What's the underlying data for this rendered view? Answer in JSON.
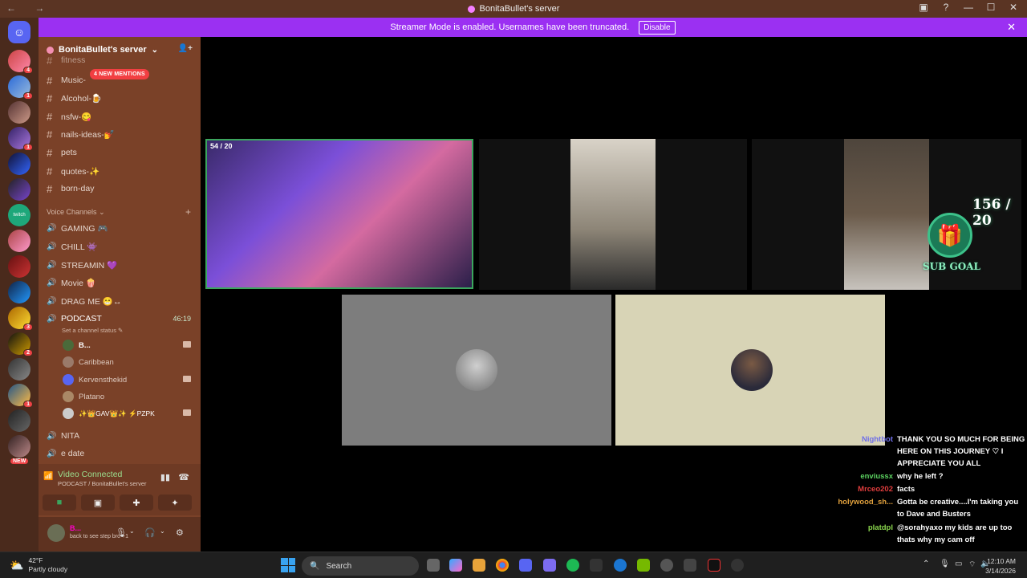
{
  "window": {
    "title": "BonitaBullet's server",
    "nav": "← →"
  },
  "window_controls": [
    "▣",
    "?",
    "—",
    "☐",
    "✕"
  ],
  "streamer_bar": {
    "message": "Streamer Mode is enabled. Usernames have been truncated.",
    "button": "Disable",
    "close": "✕"
  },
  "guilds": [
    {
      "badge": ""
    },
    {
      "badge": "4"
    },
    {
      "badge": "1"
    },
    {
      "badge": ""
    },
    {
      "badge": "1"
    },
    {
      "badge": ""
    },
    {
      "badge": ""
    },
    {
      "badge": ""
    },
    {
      "badge": ""
    },
    {
      "badge": ""
    },
    {
      "badge": ""
    },
    {
      "badge": "3"
    },
    {
      "badge": "2"
    },
    {
      "badge": ""
    },
    {
      "badge": "1"
    },
    {
      "badge": ""
    },
    {
      "badge": "NEW"
    }
  ],
  "server": {
    "name": "BonitaBullet's server",
    "chevron": "⌄",
    "invite_icon": "👤+"
  },
  "mentions_pill": "4 NEW MENTIONS",
  "text_channels": [
    {
      "name": "fitness"
    },
    {
      "name": "Music-"
    },
    {
      "name": "Alcohol-🍺"
    },
    {
      "name": "nsfw-😋"
    },
    {
      "name": "nails-ideas-💅"
    },
    {
      "name": "pets"
    },
    {
      "name": "quotes-✨"
    },
    {
      "name": "born-day"
    }
  ],
  "voice_header": "Voice Channels",
  "voice_channels": [
    {
      "name": "GAMING 🎮"
    },
    {
      "name": "CHILL 👾"
    },
    {
      "name": "STREAMIN 💜"
    },
    {
      "name": "Movie 🍿"
    },
    {
      "name": "DRAG ME 😁↔"
    },
    {
      "name": "PODCAST",
      "time": "46:19"
    }
  ],
  "podcast_status": "Set a channel status ✎",
  "members": [
    {
      "name": "B...",
      "cam": true
    },
    {
      "name": "Caribbean",
      "cam": false
    },
    {
      "name": "Kervensthekid",
      "cam": true
    },
    {
      "name": "Platano",
      "cam": false
    },
    {
      "name": "✨👑GAV👑✨ ⚡PZPK",
      "cam": true
    }
  ],
  "more_channels": [
    {
      "name": "NITA"
    },
    {
      "name": "e date"
    }
  ],
  "voice_panel": {
    "status": "Video Connected",
    "channel": "PODCAST / BonitaBullet's server"
  },
  "user": {
    "name": "B...",
    "status": "back to see step bro +1"
  },
  "stream_overlay": {
    "count": "156 / 20",
    "label": "SUB GOAL",
    "tile1_text": "54 / 20"
  },
  "chat": [
    {
      "user": "Nightbot",
      "color": "#6e6ee8",
      "msg": "THANK YOU SO MUCH FOR BEING HERE ON THIS JOURNEY ♡ I APPRECIATE YOU ALL"
    },
    {
      "user": "enviussx",
      "color": "#5bd160",
      "msg": "why he left ?"
    },
    {
      "user": "Mrceo202",
      "color": "#e03d3d",
      "msg": "facts"
    },
    {
      "user": "holywood_sh...",
      "color": "#e0a03d",
      "msg": "Gotta be creative....I'm taking you to Dave and Busters"
    },
    {
      "user": "platdpl",
      "color": "#8ad64d",
      "msg": "@sorahyaxo my kids are up too thats why my cam off"
    }
  ],
  "taskbar": {
    "weather_temp": "42°F",
    "weather_desc": "Partly cloudy",
    "search": "Search",
    "time": "12:10 AM",
    "date": "3/14/2026"
  }
}
